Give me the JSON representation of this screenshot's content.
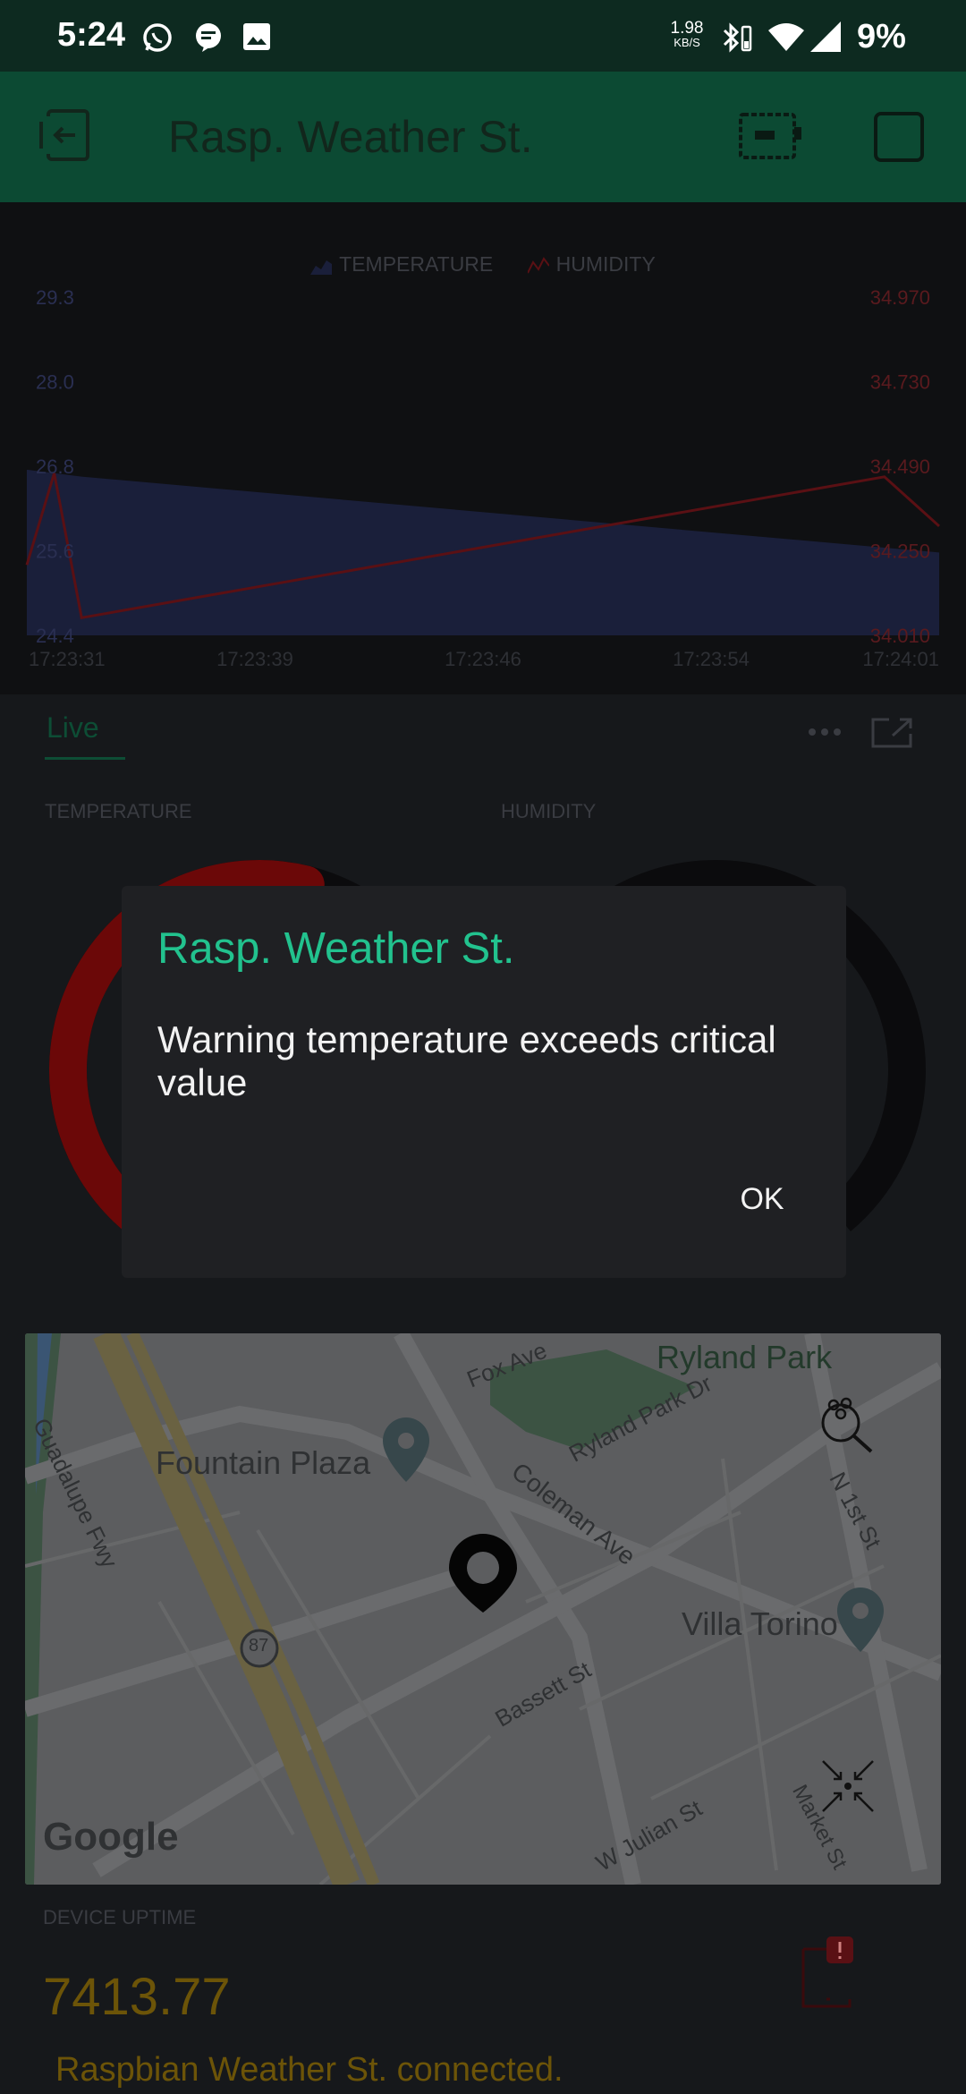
{
  "status_bar": {
    "time": "5:24",
    "net_speed_value": "1.98",
    "net_speed_unit": "KB/S",
    "battery": "9%"
  },
  "app_bar": {
    "title": "Rasp. Weather St."
  },
  "chart_data": {
    "type": "area",
    "legend": [
      "TEMPERATURE",
      "HUMIDITY"
    ],
    "x_labels": [
      "17:23:31",
      "17:23:39",
      "17:23:46",
      "17:23:54",
      "17:24:01"
    ],
    "left_axis": {
      "ticks": [
        "29.3",
        "28.0",
        "26.8",
        "25.6",
        "24.4"
      ],
      "ylim": [
        24.4,
        29.3
      ]
    },
    "right_axis": {
      "ticks": [
        "34.970",
        "34.730",
        "34.490",
        "34.250",
        "34.010"
      ],
      "ylim": [
        34.01,
        34.97
      ]
    },
    "series": [
      {
        "name": "TEMPERATURE",
        "axis": "left",
        "x": [
          0,
          0.06,
          1.0
        ],
        "values": [
          26.8,
          26.7,
          25.6
        ]
      },
      {
        "name": "HUMIDITY",
        "axis": "right",
        "x": [
          0,
          0.03,
          0.06,
          0.94,
          1.0
        ],
        "values": [
          34.21,
          34.47,
          34.06,
          34.46,
          34.32
        ]
      }
    ],
    "colors": {
      "temperature_fill": "#1a1f3a",
      "humidity_line": "#5a1014",
      "left_tick_color": "#2a2f52",
      "right_tick_color": "#5a1a1e"
    }
  },
  "tabs": {
    "live": "Live"
  },
  "gauges": {
    "temperature_label": "TEMPERATURE",
    "humidity_label": "HUMIDITY",
    "temperature_fraction": 0.55,
    "humidity_fraction": 0.0,
    "colors": {
      "temperature": "#6b0808",
      "track": "#0b0b0d"
    }
  },
  "dialog": {
    "title": "Rasp. Weather St.",
    "message": "Warning temperature exceeds critical value",
    "ok": "OK"
  },
  "map": {
    "labels": {
      "fox_ave": "Fox Ave",
      "ryland_park": "Ryland Park",
      "ryland_park_dr": "Ryland Park Dr",
      "guadalupe_fwy": "Guadalupe Fwy",
      "fountain_plaza": "Fountain Plaza",
      "coleman_ave": "Coleman Ave",
      "n_1st_st": "N 1st St",
      "villa_torino": "Villa Torino",
      "route_87": "87",
      "bassett_st": "Bassett St",
      "w_julian_st": "W Julian St",
      "market_st": "Market St",
      "google": "Google"
    }
  },
  "uptime": {
    "label": "DEVICE UPTIME",
    "value": "7413.77"
  },
  "footer": {
    "connected_message": "Raspbian Weather St. connected."
  }
}
